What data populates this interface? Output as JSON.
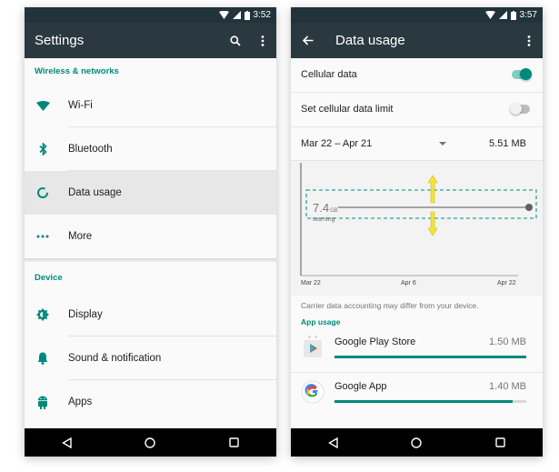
{
  "colors": {
    "accent": "#00897b",
    "accent_light": "#80cbc4",
    "toolbar": "#29393f",
    "statusbar": "#22343b",
    "arrow_yellow": "#f5e43a"
  },
  "left": {
    "status_time": "3:52",
    "toolbar": {
      "title": "Settings",
      "icons": [
        "search-icon",
        "more-vert-icon"
      ]
    },
    "sections": [
      {
        "header": "Wireless & networks",
        "items": [
          {
            "label": "Wi-Fi",
            "icon": "wifi-icon"
          },
          {
            "label": "Bluetooth",
            "icon": "bluetooth-icon"
          },
          {
            "label": "Data usage",
            "icon": "data-usage-icon",
            "selected": true
          },
          {
            "label": "More",
            "icon": "more-horiz-icon"
          }
        ]
      },
      {
        "header": "Device",
        "items": [
          {
            "label": "Display",
            "icon": "display-icon"
          },
          {
            "label": "Sound & notification",
            "icon": "bell-icon"
          },
          {
            "label": "Apps",
            "icon": "android-icon"
          }
        ]
      }
    ]
  },
  "right": {
    "status_time": "3:57",
    "toolbar": {
      "title": "Data usage",
      "icons": [
        "back-arrow-icon",
        "more-vert-icon"
      ]
    },
    "cellular_data": {
      "label": "Cellular data",
      "on": true
    },
    "data_limit": {
      "label": "Set cellular data limit",
      "on": false
    },
    "cycle": {
      "range": "Mar 22 – Apr 21",
      "total": "5.51 MB"
    },
    "chart": {
      "warning_value": "7.4",
      "warning_unit": "GB",
      "warning_label": "warning",
      "x_ticks": [
        "Mar 22",
        "Apr 6",
        "Apr 22"
      ]
    },
    "carrier_note": "Carrier data accounting may differ from your device.",
    "app_usage_header": "App usage",
    "apps": [
      {
        "name": "Google Play Store",
        "size": "1.50 MB",
        "icon": "play-store-icon",
        "fraction": 1.0
      },
      {
        "name": "Google App",
        "size": "1.40 MB",
        "icon": "google-g-icon",
        "fraction": 0.93
      }
    ]
  },
  "navbar": {
    "buttons": [
      "back-nav-icon",
      "home-nav-icon",
      "recents-nav-icon"
    ]
  }
}
